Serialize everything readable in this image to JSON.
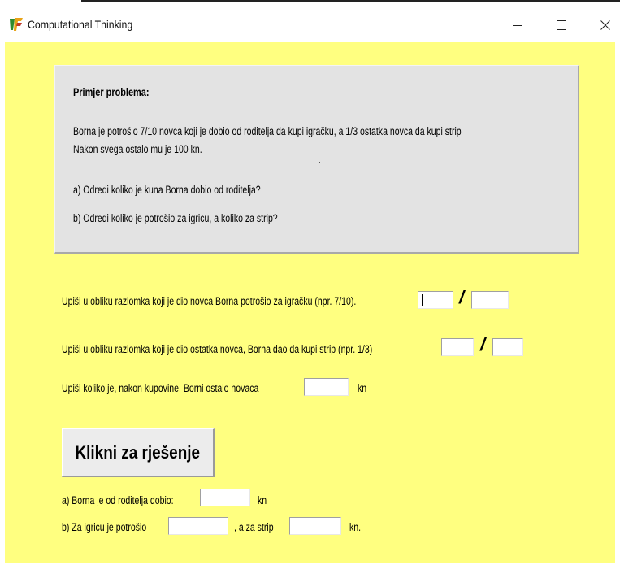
{
  "window": {
    "title": "Computational Thinking",
    "controls": {
      "minimize": "–",
      "maximize": "☐",
      "close": "X"
    }
  },
  "problem": {
    "heading": "Primjer problema:",
    "line1": "Borna je potrošio 7/10 novca  koji je dobio od roditelja da kupi igračku, a 1/3 ostatka novca da kupi strip",
    "line2": "Nakon svega ostalo mu je 100 kn.",
    "question_a": "a) Odredi koliko je kuna Borna dobio od roditelja?",
    "question_b": "b) Odredi koliko je potrošio za igricu, a koliko za strip?"
  },
  "inputs": {
    "q1_label": "Upiši u obliku razlomka koji je dio novca Borna  potrošio za igračku (npr. 7/10).",
    "q1_numerator": "",
    "q1_denominator": "",
    "q2_label": "Upiši u obliku razlomka koji je dio ostatka novca, Borna  dao da kupi strip (npr. 1/3)",
    "q2_numerator": "",
    "q2_denominator": "",
    "q3_label": "Upiši koliko je, nakon kupovine, Borni ostalo novaca",
    "q3_value": "",
    "q3_unit": "kn",
    "fraction_separator": "/"
  },
  "solve_button": {
    "label": "Klikni za rješenje"
  },
  "results": {
    "a_label": "a) Borna je od roditelja dobio:",
    "a_value": "",
    "a_unit": "kn",
    "b_label": "b) Za igricu je potrošio",
    "b_value1": "",
    "b_mid": ", a za strip",
    "b_value2": "",
    "b_unit": "kn."
  },
  "colors": {
    "client_background": "#ffff80",
    "problem_box": "#e3e3e3",
    "button_face": "#ececec"
  },
  "icons": {
    "app": "app-logo-icon",
    "minimize": "minimize-icon",
    "maximize": "maximize-icon",
    "close": "close-icon"
  }
}
